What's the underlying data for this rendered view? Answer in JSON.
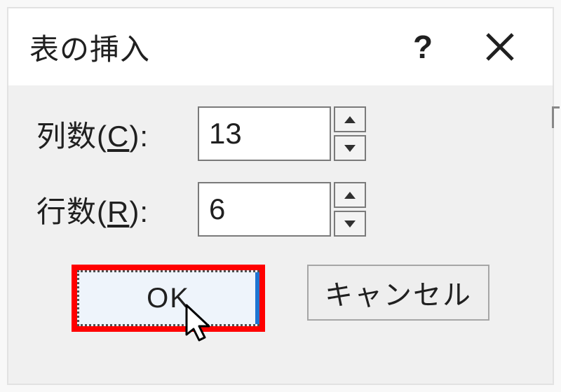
{
  "dialog": {
    "title": "表の挿入",
    "fields": {
      "columns": {
        "label_pre": "列数(",
        "hotkey": "C",
        "label_post": "):",
        "value": "13"
      },
      "rows": {
        "label_pre": "行数(",
        "hotkey": "R",
        "label_post": "):",
        "value": "6"
      }
    },
    "buttons": {
      "ok": "OK",
      "cancel": "キャンセル"
    }
  },
  "colors": {
    "highlight": "#ff0000",
    "dialog_body": "#f0f0f0",
    "ok_bg": "#eef4fb",
    "accent_blue": "#1e74d2"
  }
}
